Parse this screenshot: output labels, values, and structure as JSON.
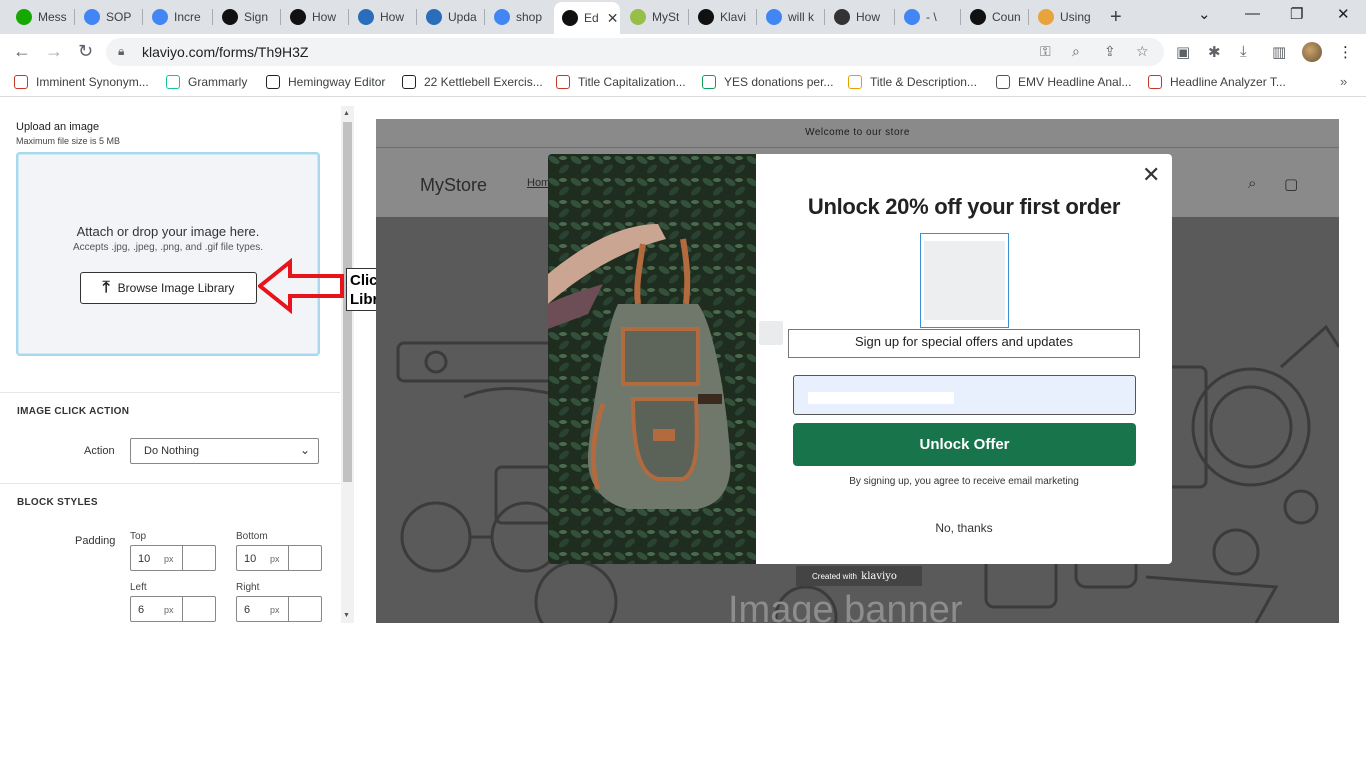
{
  "browser": {
    "tabs": [
      {
        "label": "Mess",
        "icon": "upwork-icon",
        "color": "#14a800"
      },
      {
        "label": "SOP",
        "icon": "docs-icon",
        "color": "#4285f4"
      },
      {
        "label": "Incre",
        "icon": "google-icon",
        "color": "#4285f4"
      },
      {
        "label": "Sign",
        "icon": "klaviyo-icon",
        "color": "#111111"
      },
      {
        "label": "How",
        "icon": "klaviyo-icon",
        "color": "#111111"
      },
      {
        "label": "How",
        "icon": "help-icon",
        "color": "#2a6ebb"
      },
      {
        "label": "Upda",
        "icon": "help-icon",
        "color": "#2a6ebb"
      },
      {
        "label": "shop",
        "icon": "google-icon",
        "color": "#4285f4"
      },
      {
        "label": "Ed",
        "icon": "klaviyo-icon",
        "color": "#111111",
        "active": true
      },
      {
        "label": "MySt",
        "icon": "shopify-icon",
        "color": "#95bf47"
      },
      {
        "label": "Klavi",
        "icon": "klaviyo-icon",
        "color": "#111111"
      },
      {
        "label": "will k",
        "icon": "google-icon",
        "color": "#4285f4"
      },
      {
        "label": "How",
        "icon": "flag-icon",
        "color": "#333333"
      },
      {
        "label": "- \\",
        "icon": "google-icon",
        "color": "#4285f4"
      },
      {
        "label": "Coun",
        "icon": "counter-icon",
        "color": "#111111"
      },
      {
        "label": "Using",
        "icon": "color-wheel-icon",
        "color": "#e8a33d"
      }
    ],
    "new_tab_symbol": "+",
    "url": "klaviyo.com/forms/Th9H3Z",
    "bookmarks": [
      {
        "label": "Imminent Synonym...",
        "icon": "bookmark-icon",
        "color": "#c0392b"
      },
      {
        "label": "Grammarly",
        "icon": "grammarly-icon",
        "color": "#15c39a"
      },
      {
        "label": "Hemingway Editor",
        "icon": "hemingway-icon",
        "color": "#222222"
      },
      {
        "label": "22 Kettlebell Exercis...",
        "icon": "kettlebell-icon",
        "color": "#222222"
      },
      {
        "label": "Title Capitalization...",
        "icon": "title-icon",
        "color": "#c0392b"
      },
      {
        "label": "YES donations per...",
        "icon": "sheets-icon",
        "color": "#0f9d58"
      },
      {
        "label": "Title & Description...",
        "icon": "seo-icon",
        "color": "#e6a100"
      },
      {
        "label": "EMV Headline Anal...",
        "icon": "globe-icon",
        "color": "#555555"
      },
      {
        "label": "Headline Analyzer T...",
        "icon": "title-icon",
        "color": "#c0392b"
      }
    ],
    "bookmarks_more": "»"
  },
  "editor": {
    "upload_title": "Upload an image",
    "upload_note": "Maximum file size is 5 MB",
    "drop_title": "Attach or drop your image here.",
    "drop_sub": "Accepts .jpg, .jpeg, .png, and .gif file types.",
    "browse_label": "Browse Image Library",
    "click_action_heading": "IMAGE CLICK ACTION",
    "action_label": "Action",
    "action_value": "Do Nothing",
    "block_styles_heading": "BLOCK STYLES",
    "padding_label": "Padding",
    "padding": {
      "top_label": "Top",
      "top": "10",
      "bottom_label": "Bottom",
      "bottom": "10",
      "left_label": "Left",
      "left": "6",
      "right_label": "Right",
      "right": "6",
      "unit": "px"
    }
  },
  "annotation": {
    "text": "Click Browse Library",
    "arrow_color": "#e8141c"
  },
  "store": {
    "announcement": "Welcome to our store",
    "name": "MyStore",
    "nav_home": "Home",
    "banner_text": "Image banner"
  },
  "popup": {
    "title": "Unlock 20% off your first order",
    "subtitle": "Sign up for special offers and updates",
    "button_label": "Unlock Offer",
    "button_color": "#17744b",
    "legal": "By signing up, you agree to receive email marketing",
    "decline": "No, thanks",
    "badge_prefix": "Created with",
    "badge_brand": "klaviyo"
  }
}
